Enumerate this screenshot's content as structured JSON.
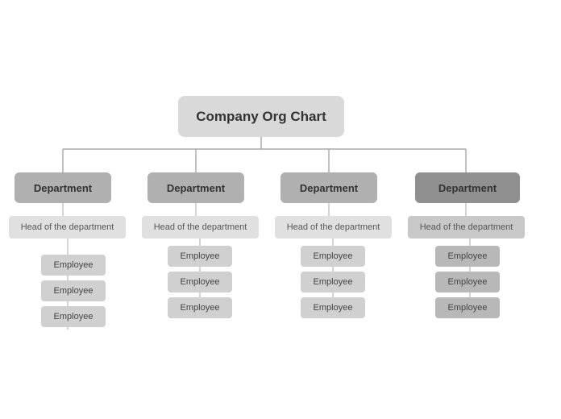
{
  "title": "Company Org Chart",
  "departments": [
    {
      "id": "dept1",
      "label": "Department",
      "head_label": "Head of the department",
      "employees": [
        "Employee",
        "Employee",
        "Employee"
      ]
    },
    {
      "id": "dept2",
      "label": "Department",
      "head_label": "Head of the department",
      "employees": [
        "Employee",
        "Employee",
        "Employee"
      ]
    },
    {
      "id": "dept3",
      "label": "Department",
      "head_label": "Head of the department",
      "employees": [
        "Employee",
        "Employee",
        "Employee"
      ]
    },
    {
      "id": "dept4",
      "label": "Department",
      "head_label": "Head of the department",
      "employees": [
        "Employee",
        "Employee",
        "Employee"
      ]
    }
  ]
}
